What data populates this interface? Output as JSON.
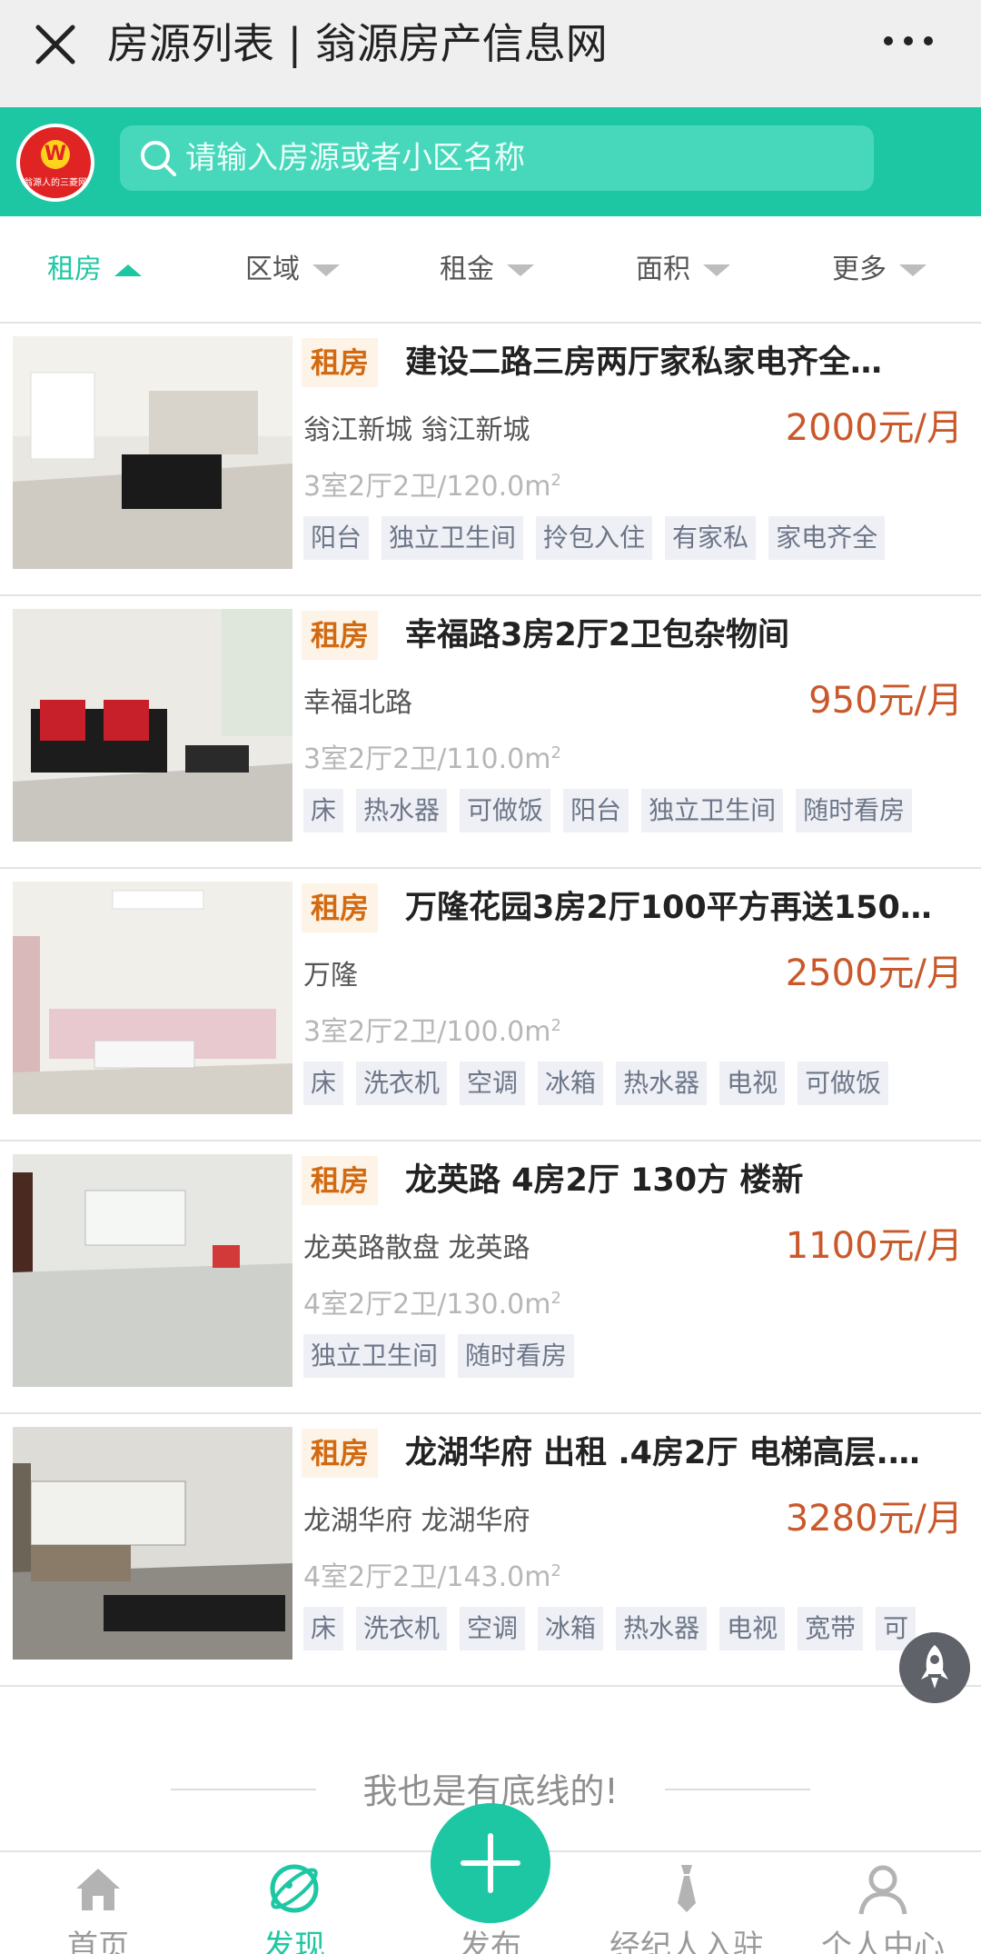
{
  "titlebar": {
    "title": "房源列表 | 翁源房产信息网",
    "close_icon": "close-icon",
    "more_icon": "more-dots-icon"
  },
  "search": {
    "logo_letter": "W",
    "logo_text": "翁源人的三菱网",
    "placeholder": "请输入房源或者小区名称"
  },
  "filters": [
    {
      "label": "租房",
      "active": true
    },
    {
      "label": "区域",
      "active": false
    },
    {
      "label": "租金",
      "active": false
    },
    {
      "label": "面积",
      "active": false
    },
    {
      "label": "更多",
      "active": false
    }
  ],
  "listings": [
    {
      "type": "租房",
      "title": "建设二路三房两厅家私家电齐全…",
      "location": "翁江新城 翁江新城",
      "price": "2000元/月",
      "layout": "3室2厅2卫/120.0m",
      "unit_sup": "2",
      "features": [
        "阳台",
        "独立卫生间",
        "拎包入住",
        "有家私",
        "家电齐全"
      ]
    },
    {
      "type": "租房",
      "title": "幸福路3房2厅2卫包杂物间",
      "location": "幸福北路",
      "price": "950元/月",
      "layout": "3室2厅2卫/110.0m",
      "unit_sup": "2",
      "features": [
        "床",
        "热水器",
        "可做饭",
        "阳台",
        "独立卫生间",
        "随时看房"
      ]
    },
    {
      "type": "租房",
      "title": "万隆花园3房2厅100平方再送150…",
      "location": "万隆",
      "price": "2500元/月",
      "layout": "3室2厅2卫/100.0m",
      "unit_sup": "2",
      "features": [
        "床",
        "洗衣机",
        "空调",
        "冰箱",
        "热水器",
        "电视",
        "可做饭"
      ]
    },
    {
      "type": "租房",
      "title": "龙英路 4房2厅 130方 楼新",
      "location": "龙英路散盘 龙英路",
      "price": "1100元/月",
      "layout": "4室2厅2卫/130.0m",
      "unit_sup": "2",
      "features": [
        "独立卫生间",
        "随时看房"
      ]
    },
    {
      "type": "租房",
      "title": "龙湖华府 出租 .4房2厅 电梯高层.…",
      "location": "龙湖华府 龙湖华府",
      "price": "3280元/月",
      "layout": "4室2厅2卫/143.0m",
      "unit_sup": "2",
      "features": [
        "床",
        "洗衣机",
        "空调",
        "冰箱",
        "热水器",
        "电视",
        "宽带",
        "可"
      ]
    }
  ],
  "footer_note": "我也是有底线的!",
  "bottom_nav": [
    {
      "label": "首页",
      "icon": "home-icon",
      "active": false
    },
    {
      "label": "发现",
      "icon": "discover-icon",
      "active": true
    },
    {
      "label": "发布",
      "icon": "plus-icon",
      "active": false
    },
    {
      "label": "经纪人入驻",
      "icon": "tie-icon",
      "active": false
    },
    {
      "label": "个人中心",
      "icon": "user-icon",
      "active": false
    }
  ],
  "colors": {
    "accent": "#1ec7a3",
    "price": "#c9592a",
    "tag_bg": "#fdf3e6",
    "tag_text": "#d26a12"
  }
}
